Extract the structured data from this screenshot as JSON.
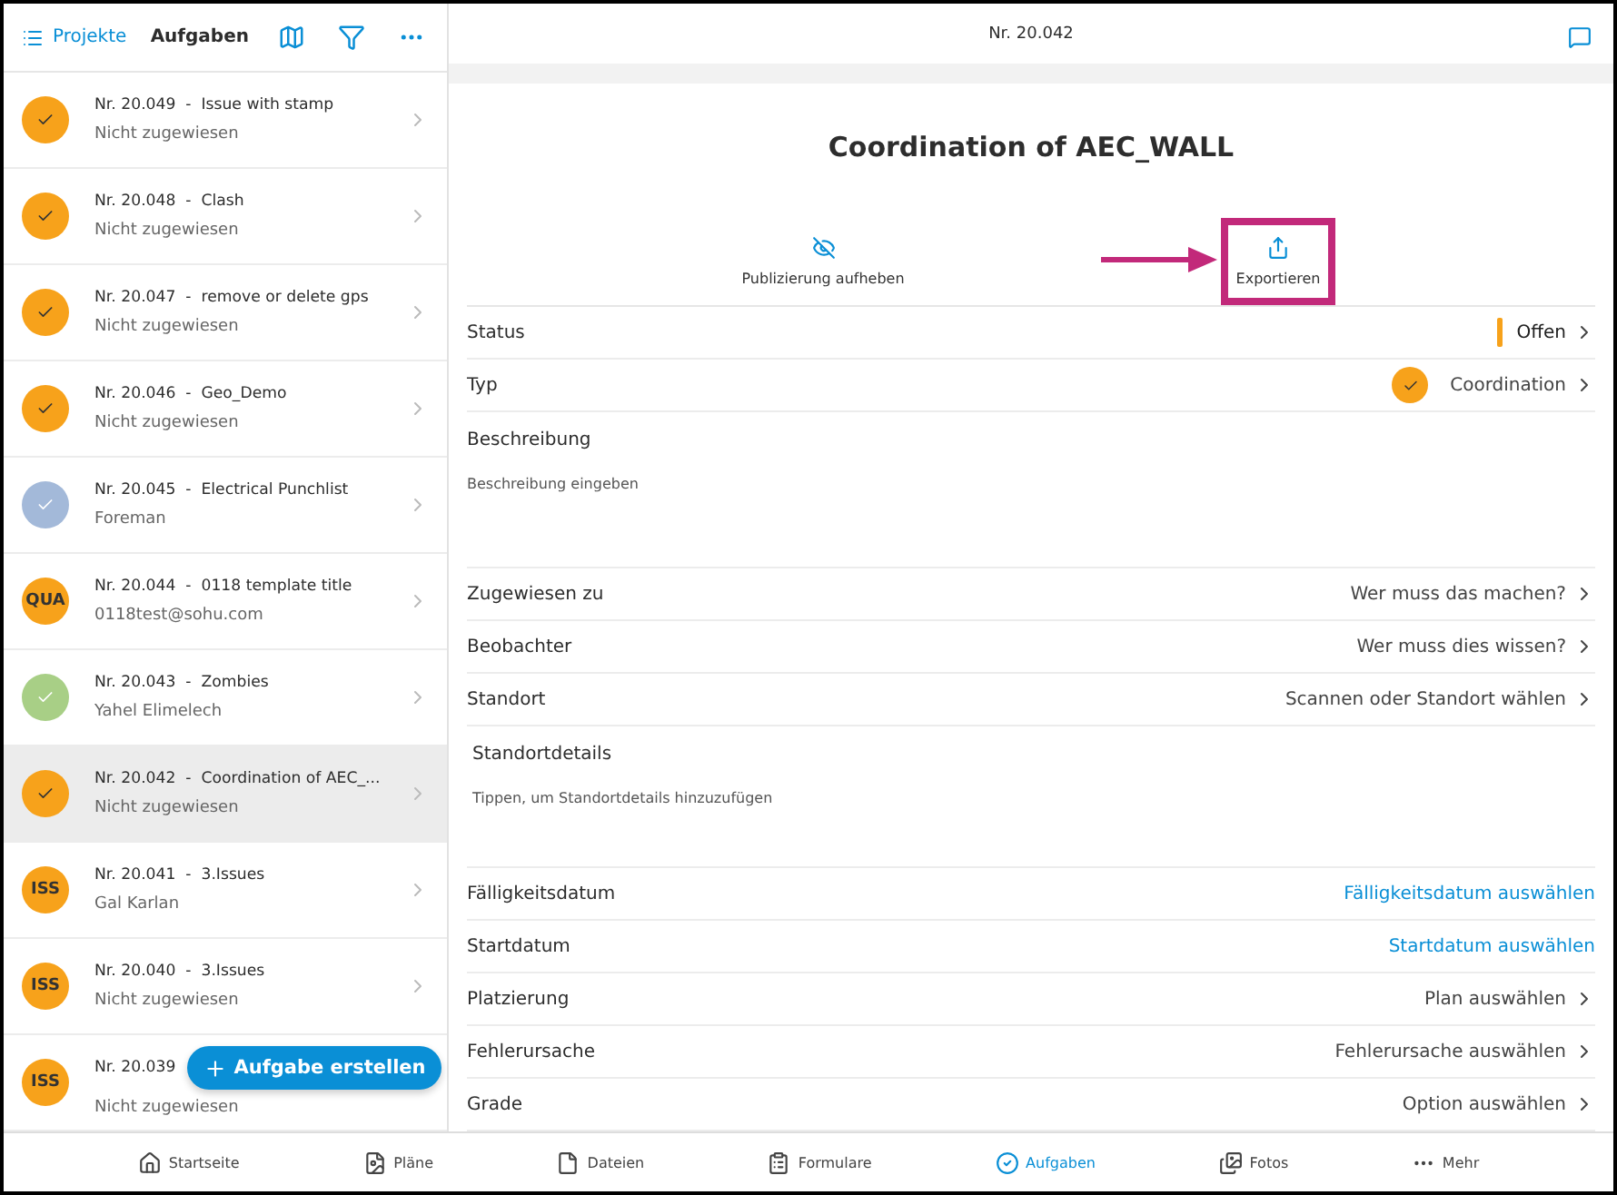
{
  "sidebar": {
    "projects_link": "Projekte",
    "title": "Aufgaben",
    "tasks": [
      {
        "title": "Nr. 20.049  -  Issue with stamp",
        "subtitle": "Nicht zugewiesen",
        "badge": {
          "kind": "check",
          "color": "#f7a21b"
        },
        "selected": false
      },
      {
        "title": "Nr. 20.048  -  Clash",
        "subtitle": "Nicht zugewiesen",
        "badge": {
          "kind": "check",
          "color": "#f7a21b"
        },
        "selected": false
      },
      {
        "title": "Nr. 20.047  -  remove or delete gps",
        "subtitle": "Nicht zugewiesen",
        "badge": {
          "kind": "check",
          "color": "#f7a21b"
        },
        "selected": false
      },
      {
        "title": "Nr. 20.046  -  Geo_Demo",
        "subtitle": "Nicht zugewiesen",
        "badge": {
          "kind": "check",
          "color": "#f7a21b"
        },
        "selected": false
      },
      {
        "title": "Nr. 20.045  -  Electrical Punchlist",
        "subtitle": "Foreman",
        "badge": {
          "kind": "check",
          "color": "#a3b9d9"
        },
        "selected": false
      },
      {
        "title": "Nr. 20.044  -  0118 template title",
        "subtitle": "0118test@sohu.com",
        "badge": {
          "kind": "text",
          "label": "QUA",
          "color": "#f7a21b"
        },
        "selected": false
      },
      {
        "title": "Nr. 20.043  -  Zombies",
        "subtitle": "Yahel Elimelech",
        "badge": {
          "kind": "check",
          "color": "#a8cf86"
        },
        "selected": false
      },
      {
        "title": "Nr. 20.042  -  Coordination of AEC_...",
        "subtitle": "Nicht zugewiesen",
        "badge": {
          "kind": "check",
          "color": "#f7a21b"
        },
        "selected": true
      },
      {
        "title": "Nr. 20.041  -  3.Issues",
        "subtitle": "Gal Karlan",
        "badge": {
          "kind": "text",
          "label": "ISS",
          "color": "#f7a21b"
        },
        "selected": false
      },
      {
        "title": "Nr. 20.040  -  3.Issues",
        "subtitle": "Nicht zugewiesen",
        "badge": {
          "kind": "text",
          "label": "ISS",
          "color": "#f7a21b"
        },
        "selected": false
      },
      {
        "title": "Nr. 20.039",
        "subtitle": "Nicht zugewiesen",
        "badge": {
          "kind": "text",
          "label": "ISS",
          "color": "#f7a21b"
        },
        "selected": false
      }
    ],
    "create_button": "Aufgabe erstellen"
  },
  "detail": {
    "header_title": "Nr. 20.042",
    "title": "Coordination of AEC_WALL",
    "actions": [
      {
        "kind": "unpublish",
        "label": "Publizierung aufheben",
        "highlighted": false
      },
      {
        "kind": "export",
        "label": "Exportieren",
        "highlighted": true
      }
    ],
    "fields": [
      {
        "kind": "status",
        "label": "Status",
        "value": "Offen",
        "color": "#f7a21b"
      },
      {
        "kind": "type",
        "label": "Typ",
        "value": "Coordination",
        "color": "#f7a21b"
      },
      {
        "kind": "text",
        "label": "Beschreibung",
        "placeholder": "Beschreibung eingeben"
      },
      {
        "kind": "select",
        "label": "Zugewiesen zu",
        "value": "Wer muss das machen?"
      },
      {
        "kind": "select",
        "label": "Beobachter",
        "value": "Wer muss dies wissen?"
      },
      {
        "kind": "select",
        "label": "Standort",
        "value": "Scannen oder Standort wählen"
      },
      {
        "kind": "text",
        "label": "Standortdetails",
        "placeholder": "Tippen, um Standortdetails hinzuzufügen"
      },
      {
        "kind": "link",
        "label": "Fälligkeitsdatum",
        "value": "Fälligkeitsdatum auswählen"
      },
      {
        "kind": "link",
        "label": "Startdatum",
        "value": "Startdatum auswählen"
      },
      {
        "kind": "select",
        "label": "Platzierung",
        "value": "Plan auswählen"
      },
      {
        "kind": "select",
        "label": "Fehlerursache",
        "value": "Fehlerursache auswählen"
      },
      {
        "kind": "select",
        "label": "Grade",
        "value": "Option auswählen"
      }
    ]
  },
  "bottom_nav": [
    {
      "kind": "home",
      "label": "Startseite",
      "selected": false
    },
    {
      "kind": "plans",
      "label": "Pläne",
      "selected": false
    },
    {
      "kind": "files",
      "label": "Dateien",
      "selected": false
    },
    {
      "kind": "forms",
      "label": "Formulare",
      "selected": false
    },
    {
      "kind": "tasks",
      "label": "Aufgaben",
      "selected": true
    },
    {
      "kind": "photos",
      "label": "Fotos",
      "selected": false
    },
    {
      "kind": "more",
      "label": "Mehr",
      "selected": false
    }
  ]
}
